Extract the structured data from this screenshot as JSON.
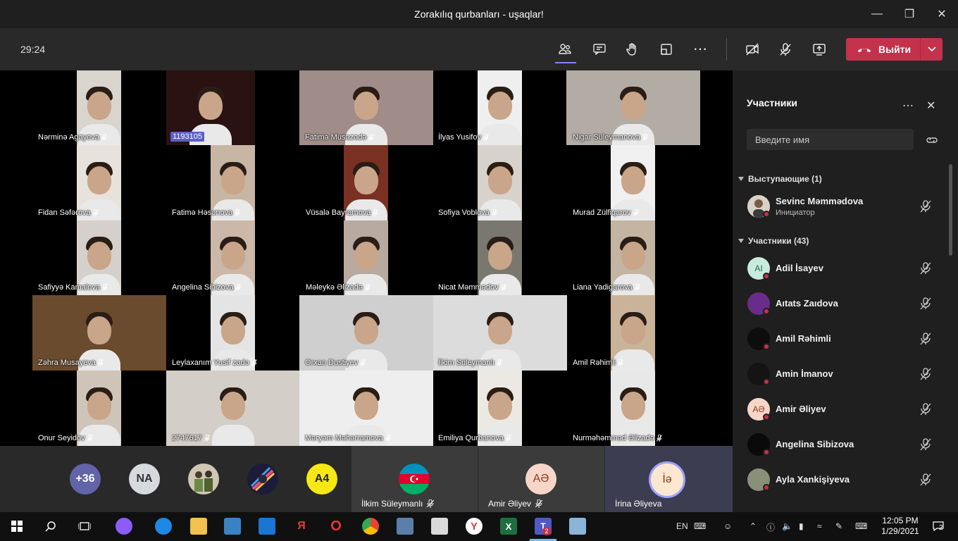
{
  "window": {
    "title": "Zorakılıq qurbanları - uşaqlar!"
  },
  "meeting": {
    "timer": "29:24",
    "leave_label": "Выйти"
  },
  "tiles": [
    {
      "name": "Nərminə Agayeva",
      "muted": true
    },
    {
      "name": "1193105",
      "id_tag": true,
      "muted": false
    },
    {
      "name": "Fatimə Musazadə",
      "muted": true
    },
    {
      "name": "İlyas Yusifov",
      "muted": true
    },
    {
      "name": "Nigar Süleymanova",
      "muted": true
    },
    {
      "name": "Fidan Səfərova",
      "muted": true
    },
    {
      "name": "Fatimə Həsənova",
      "muted": true
    },
    {
      "name": "Vüsalə Bayramova",
      "muted": true
    },
    {
      "name": "Sofiya Voblova",
      "muted": true
    },
    {
      "name": "Murad Zülfiqarov",
      "muted": true
    },
    {
      "name": "Safiyyə Kamalova",
      "muted": true
    },
    {
      "name": "Angelina Sibizova",
      "muted": true
    },
    {
      "name": "Məleykə Əlizadə",
      "muted": true
    },
    {
      "name": "Nicat Məmmədov",
      "muted": true
    },
    {
      "name": "Liana Yadigarova",
      "muted": true
    },
    {
      "name": "Zəhra Musayeva",
      "muted": true
    },
    {
      "name": "Leylaxanım Yusif zadə",
      "muted": true
    },
    {
      "name": "Orxan Dustiyev",
      "muted": true
    },
    {
      "name": "İlkim Süleymanlı",
      "muted": true
    },
    {
      "name": "Amil Rəhimli",
      "muted": true
    },
    {
      "name": "Onur Seyidov",
      "muted": true
    },
    {
      "name": "2747617",
      "muted": true
    },
    {
      "name": "Məryəm Məhərramova",
      "muted": true
    },
    {
      "name": "Emiliya Qurbanova",
      "muted": true
    },
    {
      "name": "Nurməhəmməd Əlizadə",
      "muted": true
    }
  ],
  "strip": {
    "overflow_count": "+36",
    "avatars": [
      {
        "initials": "NA",
        "color": "#d6dade",
        "text_color": "#333"
      },
      {
        "initials": "",
        "color": "#8a8a7a"
      },
      {
        "initials": "",
        "color": "#2c2a4a"
      },
      {
        "initials": "A4",
        "color": "#f5e814",
        "text_color": "#222"
      }
    ],
    "tiles": [
      {
        "name": "İlkim Süleymanlı",
        "avatar": "",
        "avatar_color": "#0092bc"
      },
      {
        "name": "Amir Əliyev",
        "avatar": "AƏ",
        "avatar_color": "#f6d6c8"
      },
      {
        "name": "İrina Əliyeva",
        "avatar": "İə",
        "avatar_color": "#fbe6d0"
      }
    ]
  },
  "panel": {
    "title": "Участники",
    "search_placeholder": "Введите имя",
    "presenters_header": "Выступающие (1)",
    "attendees_header": "Участники (43)",
    "presenters": [
      {
        "name": "Sevinc Məmmədova",
        "role": "Инициатор",
        "avatar_color": "#c9b8a6"
      }
    ],
    "attendees": [
      {
        "name": "Adil İsayev",
        "initials": "AI",
        "avatar_color": "#c7ebdc",
        "text_color": "#1f6b4c"
      },
      {
        "name": "Aıtats Zaıdova",
        "initials": "",
        "avatar_color": "#6a2c8a"
      },
      {
        "name": "Amil Rəhimli",
        "initials": "",
        "avatar_color": "#0d0d0d"
      },
      {
        "name": "Amin İmanov",
        "initials": "",
        "avatar_color": "#141414"
      },
      {
        "name": "Amir Əliyev",
        "initials": "AƏ",
        "avatar_color": "#f6d6c8",
        "text_color": "#8a3b1a"
      },
      {
        "name": "Angelina Sibizova",
        "initials": "",
        "avatar_color": "#0a0a0a"
      },
      {
        "name": "Ayla Xankişiyeva",
        "initials": "",
        "avatar_color": "#8a8f7a"
      }
    ]
  },
  "taskbar": {
    "lang": "EN",
    "time": "12:05 PM",
    "date": "1/29/2021",
    "notification_count": "2",
    "teams_badge": "2"
  }
}
